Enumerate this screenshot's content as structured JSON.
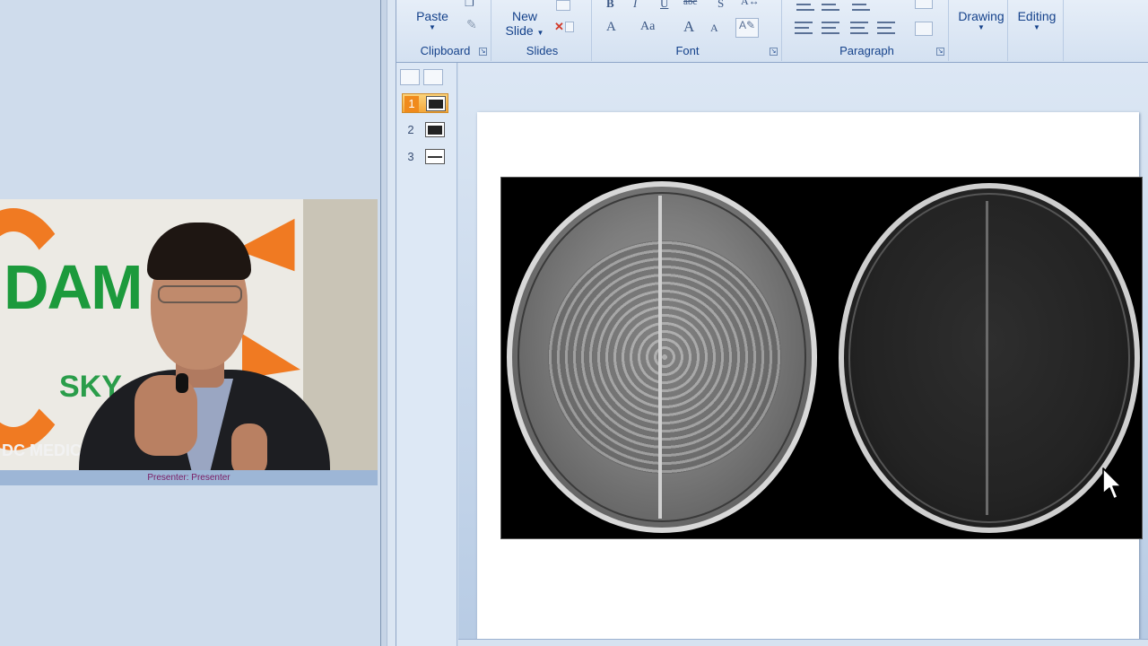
{
  "presenter": {
    "caption": "Presenter: Presenter"
  },
  "ribbon": {
    "clipboard": {
      "paste_label": "Paste",
      "group_label": "Clipboard"
    },
    "slides": {
      "new_slide_line1": "New",
      "new_slide_line2": "Slide",
      "group_label": "Slides"
    },
    "font": {
      "group_label": "Font",
      "bold": "B",
      "italic": "I",
      "underline": "U",
      "strike": "abc",
      "shadow": "S",
      "font_color": "A",
      "change_case": "Aa",
      "grow": "A",
      "shrink": "A"
    },
    "paragraph": {
      "group_label": "Paragraph"
    },
    "drawing_label": "Drawing",
    "editing_label": "Editing"
  },
  "thumbnails": {
    "items": [
      {
        "number": "1",
        "active": true
      },
      {
        "number": "2",
        "active": false
      },
      {
        "number": "3",
        "active": false
      }
    ]
  },
  "colors": {
    "ribbon_text": "#15428b",
    "active_thumb": "#f4a73a",
    "caption_text": "#7a1c64",
    "slide_bg": "#ffffff"
  },
  "icons": [
    "cut-icon",
    "copy-icon",
    "format-painter-icon",
    "delete-slide-icon",
    "clear-formatting-icon",
    "align-left-icon",
    "align-center-icon",
    "align-right-icon",
    "justify-icon",
    "mouse-cursor-icon"
  ]
}
